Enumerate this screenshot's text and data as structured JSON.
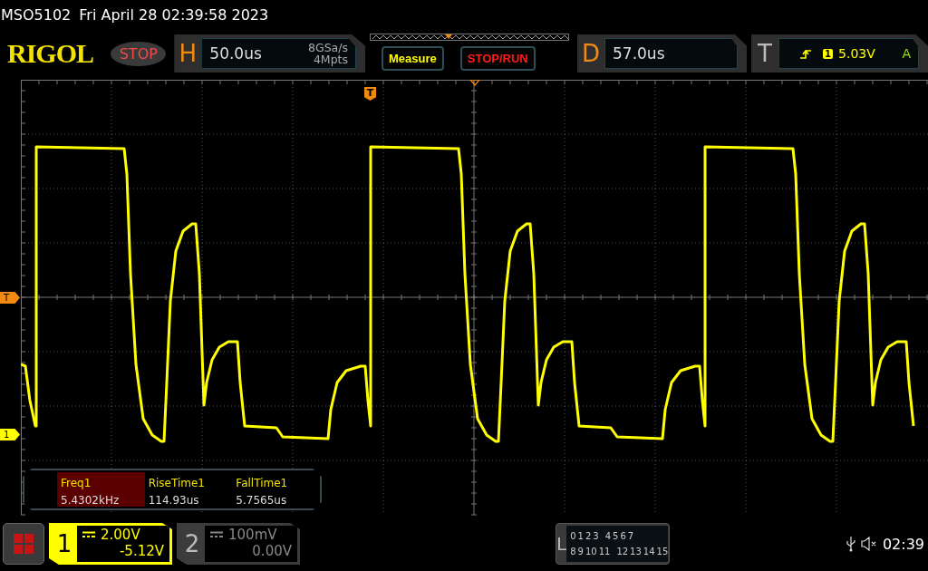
{
  "header": {
    "model": "MSO5102",
    "datetime": "Fri April 28 02:39:58 2023"
  },
  "toolbar": {
    "logo": "RIGOL",
    "run_state": "STOP",
    "horizontal": {
      "label": "H",
      "timebase": "50.0us",
      "sample_rate": "8GSa/s",
      "memory_depth": "4Mpts"
    },
    "buttons": [
      {
        "label": "Measure",
        "kind": "menu"
      },
      {
        "label": "STOP/RUN",
        "kind": "run"
      }
    ],
    "delay": {
      "label": "D",
      "value": "57.0us"
    },
    "trigger": {
      "label": "T",
      "source": "1",
      "level": "5.03V",
      "mode": "A"
    }
  },
  "screen": {
    "trigger_position_marker": "T",
    "trigger_level_marker": "T",
    "channel_marker": "1",
    "measurements": [
      {
        "name": "Freq1",
        "value": "5.4302kHz",
        "selected": true
      },
      {
        "name": "RiseTime1",
        "value": "114.93us",
        "selected": false
      },
      {
        "name": "FallTime1",
        "value": "5.7565us",
        "selected": false
      }
    ]
  },
  "channels": [
    {
      "number": "1",
      "scale": "2.00V",
      "offset": "-5.12V",
      "selected": true
    },
    {
      "number": "2",
      "scale": "100mV",
      "offset": "0.00V",
      "selected": false
    }
  ],
  "logic": {
    "label": "L",
    "bits_row_1": [
      "0",
      "1",
      "2",
      "3",
      "4",
      "5",
      "6",
      "7"
    ],
    "bits_row_2": [
      "8",
      "9",
      "10",
      "11",
      "12",
      "13",
      "14",
      "15"
    ]
  },
  "status_bar": {
    "clock": "02:39"
  }
}
